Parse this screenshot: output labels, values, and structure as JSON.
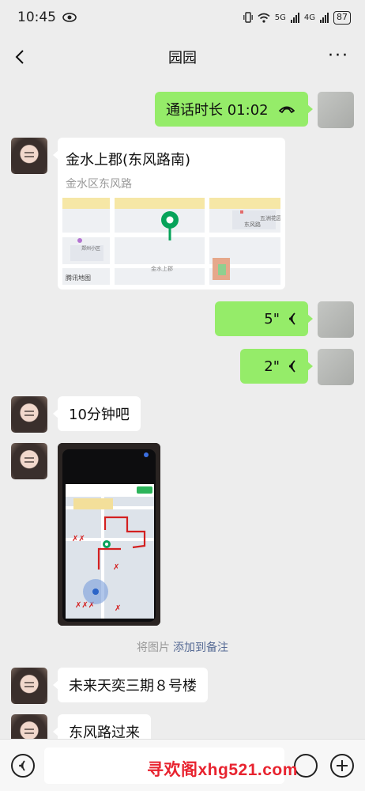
{
  "status_bar": {
    "time": "10:45",
    "battery": "87",
    "network_5g": "5G",
    "network_4g": "4G"
  },
  "nav": {
    "title": "园园",
    "more": "···"
  },
  "messages": {
    "call": {
      "text": "通话时长 01:02"
    },
    "location": {
      "title": "金水上郡(东风路南)",
      "address": "金水区东风路",
      "map_credit": "腾讯地图",
      "map_labels": [
        "金水上郡",
        "东风路",
        "五洲花园",
        "郑州小区"
      ]
    },
    "voice_1": {
      "duration": "5\""
    },
    "voice_2": {
      "duration": "2\""
    },
    "text_1": {
      "text": "10分钟吧"
    },
    "photo": {
      "alt": "地图截图"
    },
    "system_note": {
      "prefix": "将图片",
      "link": "添加到备注"
    },
    "text_2": {
      "text": "未来天奕三期８号楼"
    },
    "text_3": {
      "text": "东风路过来"
    }
  },
  "watermark": "寻欢阁xhg521.com",
  "colors": {
    "self_bubble": "#95ec69",
    "other_bubble": "#ffffff",
    "background": "#ededed",
    "link": "#576b95",
    "watermark": "#e8232f"
  },
  "icons": [
    "eye-icon",
    "back-arrow-icon",
    "more-icon",
    "hangup-icon",
    "voice-wave-icon",
    "map-pin-icon",
    "voice-input-icon",
    "emoji-icon",
    "plus-icon"
  ]
}
